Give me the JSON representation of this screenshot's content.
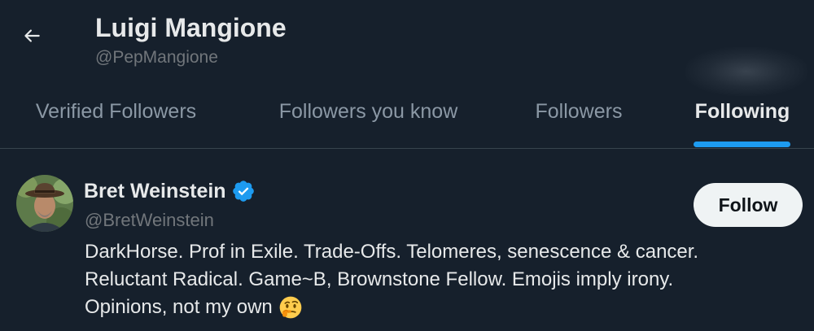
{
  "header": {
    "title": "Luigi Mangione",
    "handle": "@PepMangione",
    "back_icon": "arrow-left-icon"
  },
  "tabs": [
    {
      "label": "Verified Followers",
      "active": false
    },
    {
      "label": "Followers you know",
      "active": false
    },
    {
      "label": "Followers",
      "active": false
    },
    {
      "label": "Following",
      "active": true
    }
  ],
  "accent_color": "#1d9bf0",
  "user": {
    "name": "Bret Weinstein",
    "verified": true,
    "verified_icon": "verified-badge-icon",
    "handle": "@BretWeinstein",
    "follow_label": "Follow",
    "bio_lines": [
      "DarkHorse. Prof in Exile. Trade-Offs. Telomeres, senescence & cancer.",
      "Reluctant Radical. Game~B, Brownstone Fellow. Emojis imply irony.",
      "Opinions, not my own"
    ],
    "bio_emoji": "thinking-face-emoji"
  }
}
